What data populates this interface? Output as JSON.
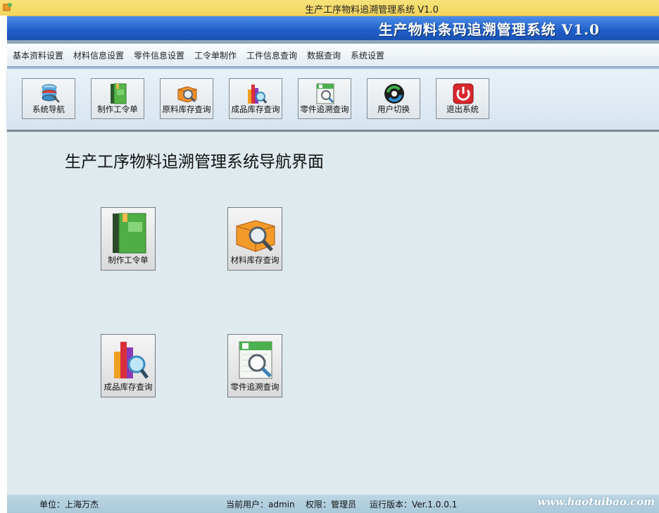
{
  "window": {
    "title": "生产工序物料追溯管理系统 V1.0"
  },
  "banner": {
    "title": "生产物料条码追溯管理系统 V1.0"
  },
  "menu": {
    "items": [
      "基本资料设置",
      "材料信息设置",
      "零件信息设置",
      "工令单制作",
      "工件信息查询",
      "数据查询",
      "系统设置"
    ]
  },
  "toolbar": {
    "buttons": [
      {
        "label": "系统导航",
        "icon": "database-icon"
      },
      {
        "label": "制作工令单",
        "icon": "green-book-icon"
      },
      {
        "label": "原料库存查询",
        "icon": "orange-box-search-icon"
      },
      {
        "label": "成品库存查询",
        "icon": "bar-chart-search-icon"
      },
      {
        "label": "零件追溯查询",
        "icon": "document-search-icon"
      },
      {
        "label": "用户切换",
        "icon": "user-switch-icon"
      },
      {
        "label": "退出系统",
        "icon": "power-icon"
      }
    ]
  },
  "main": {
    "heading": "生产工序物料追溯管理系统导航界面",
    "tiles": [
      {
        "label": "制作工令单",
        "icon": "green-book-icon"
      },
      {
        "label": "材料库存查询",
        "icon": "orange-box-search-icon"
      },
      {
        "label": "成品库存查询",
        "icon": "bar-chart-search-icon"
      },
      {
        "label": "零件追溯查询",
        "icon": "document-search-icon"
      }
    ]
  },
  "status": {
    "unit": "单位：上海万杰",
    "user": "当前用户：admin",
    "role": "权限：管理员",
    "version": "运行版本：Ver.1.0.0.1"
  },
  "watermark": "www.haotuibao.com",
  "colors": {
    "banner": "#1f5ec8",
    "titlebar": "#f3d65e",
    "content_bg": "#dfeaee",
    "status_bg": "#a9c9da"
  }
}
